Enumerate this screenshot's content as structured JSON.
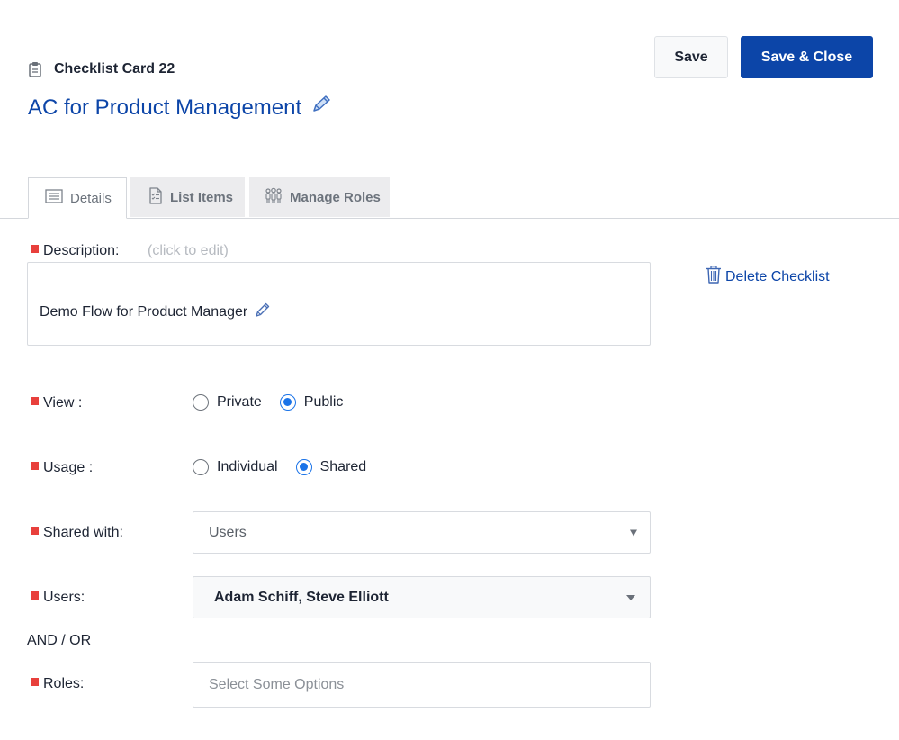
{
  "header": {
    "card_label": "Checklist Card 22",
    "title": "AC for Product Management",
    "save_label": "Save",
    "save_close_label": "Save & Close"
  },
  "tabs": [
    {
      "label": "Details",
      "icon": "document-lines-icon",
      "active": true
    },
    {
      "label": "List Items",
      "icon": "checklist-doc-icon",
      "active": false
    },
    {
      "label": "Manage Roles",
      "icon": "people-icon",
      "active": false
    }
  ],
  "form": {
    "description": {
      "label": "Description:",
      "hint": "(click to edit)",
      "value": "Demo Flow for Product Manager"
    },
    "delete_label": "Delete Checklist",
    "view": {
      "label": "View :",
      "options": [
        {
          "label": "Private",
          "checked": false
        },
        {
          "label": "Public",
          "checked": true
        }
      ]
    },
    "usage": {
      "label": "Usage :",
      "options": [
        {
          "label": "Individual",
          "checked": false
        },
        {
          "label": "Shared",
          "checked": true
        }
      ]
    },
    "shared_with": {
      "label": "Shared with:",
      "value": "Users"
    },
    "users": {
      "label": "Users:",
      "value": "Adam Schiff, Steve Elliott"
    },
    "and_or": "AND / OR",
    "roles": {
      "label": "Roles:",
      "placeholder": "Select Some Options"
    }
  },
  "colors": {
    "primary": "#0c45a8",
    "required": "#e8403c",
    "radio_checked": "#1a73e8"
  }
}
